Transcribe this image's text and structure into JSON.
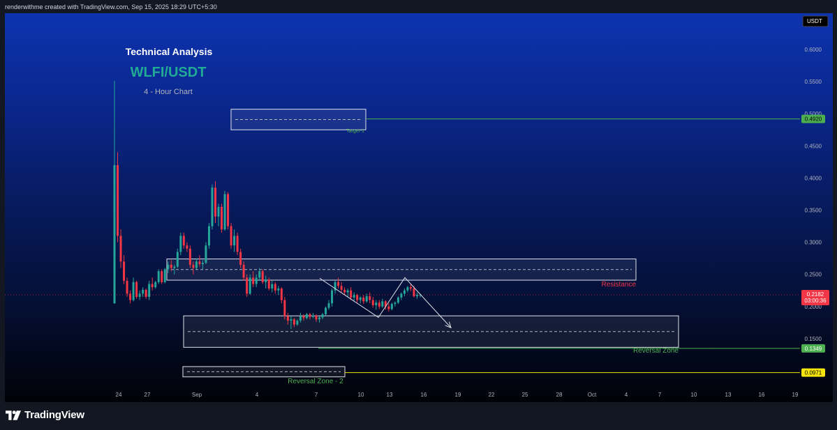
{
  "header": {
    "credit": "renderwithme created with TradingView.com, Sep 15, 2025 18:29 UTC+5:30"
  },
  "footer": {
    "brand": "TradingView"
  },
  "chart_data": {
    "type": "candlestick",
    "title": "Technical Analysis",
    "symbol": "WLFI/USDT",
    "subtitle": "4 - Hour Chart",
    "currency": "USDT",
    "ylim": [
      0.05,
      0.64
    ],
    "y_ticks": [
      "0.6000",
      "0.5500",
      "0.5000",
      "0.4500",
      "0.4000",
      "0.3500",
      "0.3000",
      "0.2500",
      "0.2000",
      "0.1500"
    ],
    "x_ticks": [
      "24",
      "27",
      "Sep",
      "4",
      "7",
      "10",
      "13",
      "16",
      "19",
      "22",
      "25",
      "28",
      "Oct",
      "4",
      "7",
      "10",
      "13",
      "16",
      "19"
    ],
    "last_price": {
      "value": "0.2182",
      "countdown": "03:00:36",
      "color": "#f23645"
    },
    "levels": [
      {
        "label": "0.4920",
        "value": 0.492,
        "color": "#4caf50",
        "text_color": "#000000"
      },
      {
        "label": "0.1349",
        "value": 0.1349,
        "color": "#4caf50",
        "text_color": "#ffffff"
      },
      {
        "label": "0.0971",
        "value": 0.0971,
        "color": "#f5e50a",
        "text_color": "#000000"
      }
    ],
    "zones": [
      {
        "label": "Target-1",
        "top": 0.507,
        "bottom": 0.475,
        "color": "#4caf50"
      },
      {
        "label": "Resistance",
        "top": 0.274,
        "bottom": 0.241,
        "color": "#f23645"
      },
      {
        "label": "Reversal Zone",
        "top": 0.1855,
        "bottom": 0.1365,
        "color": "#4caf50"
      },
      {
        "label": "Reversal Zone - 2",
        "top": 0.1065,
        "bottom": 0.0905,
        "color": "#4caf50"
      }
    ],
    "path_points": [
      [
        "Sep 7",
        0.244
      ],
      [
        "Sep 12",
        0.183
      ],
      [
        "Sep 14",
        0.245
      ],
      [
        "Sep 19",
        0.167
      ]
    ],
    "colors": {
      "up": "#26a69a",
      "down": "#f23645"
    },
    "ohlc": [
      [
        0.205,
        0.435,
        0.205,
        0.42
      ],
      [
        0.42,
        0.44,
        0.3,
        0.31
      ],
      [
        0.31,
        0.32,
        0.26,
        0.27
      ],
      [
        0.27,
        0.28,
        0.235,
        0.24
      ],
      [
        0.24,
        0.245,
        0.215,
        0.22
      ],
      [
        0.22,
        0.225,
        0.205,
        0.21
      ],
      [
        0.21,
        0.245,
        0.208,
        0.238
      ],
      [
        0.238,
        0.24,
        0.212,
        0.215
      ],
      [
        0.215,
        0.225,
        0.21,
        0.22
      ],
      [
        0.22,
        0.23,
        0.215,
        0.226
      ],
      [
        0.226,
        0.228,
        0.212,
        0.215
      ],
      [
        0.215,
        0.24,
        0.21,
        0.235
      ],
      [
        0.235,
        0.245,
        0.225,
        0.23
      ],
      [
        0.23,
        0.24,
        0.228,
        0.238
      ],
      [
        0.238,
        0.258,
        0.235,
        0.255
      ],
      [
        0.255,
        0.258,
        0.235,
        0.238
      ],
      [
        0.238,
        0.26,
        0.236,
        0.258
      ],
      [
        0.258,
        0.27,
        0.252,
        0.265
      ],
      [
        0.265,
        0.272,
        0.255,
        0.26
      ],
      [
        0.26,
        0.265,
        0.25,
        0.262
      ],
      [
        0.262,
        0.29,
        0.26,
        0.285
      ],
      [
        0.285,
        0.315,
        0.28,
        0.31
      ],
      [
        0.31,
        0.315,
        0.29,
        0.295
      ],
      [
        0.295,
        0.3,
        0.285,
        0.29
      ],
      [
        0.29,
        0.295,
        0.26,
        0.265
      ],
      [
        0.265,
        0.27,
        0.25,
        0.26
      ],
      [
        0.26,
        0.275,
        0.258,
        0.27
      ],
      [
        0.27,
        0.28,
        0.262,
        0.266
      ],
      [
        0.266,
        0.272,
        0.258,
        0.268
      ],
      [
        0.268,
        0.3,
        0.266,
        0.295
      ],
      [
        0.295,
        0.33,
        0.29,
        0.325
      ],
      [
        0.325,
        0.39,
        0.32,
        0.385
      ],
      [
        0.385,
        0.395,
        0.33,
        0.34
      ],
      [
        0.34,
        0.36,
        0.325,
        0.355
      ],
      [
        0.355,
        0.36,
        0.315,
        0.32
      ],
      [
        0.32,
        0.38,
        0.318,
        0.375
      ],
      [
        0.375,
        0.378,
        0.32,
        0.325
      ],
      [
        0.325,
        0.33,
        0.29,
        0.295
      ],
      [
        0.295,
        0.32,
        0.285,
        0.31
      ],
      [
        0.31,
        0.315,
        0.28,
        0.285
      ],
      [
        0.285,
        0.29,
        0.26,
        0.265
      ],
      [
        0.265,
        0.27,
        0.24,
        0.245
      ],
      [
        0.245,
        0.25,
        0.215,
        0.22
      ],
      [
        0.22,
        0.25,
        0.218,
        0.245
      ],
      [
        0.245,
        0.255,
        0.23,
        0.235
      ],
      [
        0.235,
        0.25,
        0.23,
        0.245
      ],
      [
        0.245,
        0.26,
        0.24,
        0.255
      ],
      [
        0.255,
        0.258,
        0.235,
        0.238
      ],
      [
        0.238,
        0.248,
        0.228,
        0.242
      ],
      [
        0.242,
        0.245,
        0.225,
        0.228
      ],
      [
        0.228,
        0.24,
        0.222,
        0.235
      ],
      [
        0.235,
        0.238,
        0.22,
        0.225
      ],
      [
        0.225,
        0.232,
        0.218,
        0.228
      ],
      [
        0.228,
        0.23,
        0.205,
        0.21
      ],
      [
        0.21,
        0.215,
        0.18,
        0.185
      ],
      [
        0.185,
        0.19,
        0.172,
        0.178
      ],
      [
        0.178,
        0.185,
        0.165,
        0.18
      ],
      [
        0.18,
        0.182,
        0.168,
        0.172
      ],
      [
        0.172,
        0.18,
        0.17,
        0.178
      ],
      [
        0.178,
        0.19,
        0.175,
        0.185
      ],
      [
        0.185,
        0.188,
        0.178,
        0.182
      ],
      [
        0.182,
        0.19,
        0.18,
        0.188
      ],
      [
        0.188,
        0.19,
        0.18,
        0.184
      ],
      [
        0.184,
        0.19,
        0.182,
        0.186
      ],
      [
        0.186,
        0.188,
        0.176,
        0.18
      ],
      [
        0.18,
        0.185,
        0.175,
        0.183
      ],
      [
        0.183,
        0.19,
        0.18,
        0.188
      ],
      [
        0.188,
        0.2,
        0.186,
        0.198
      ],
      [
        0.198,
        0.21,
        0.195,
        0.205
      ],
      [
        0.205,
        0.228,
        0.2,
        0.225
      ],
      [
        0.225,
        0.24,
        0.22,
        0.238
      ],
      [
        0.238,
        0.245,
        0.228,
        0.232
      ],
      [
        0.232,
        0.238,
        0.222,
        0.226
      ],
      [
        0.226,
        0.23,
        0.218,
        0.222
      ],
      [
        0.222,
        0.228,
        0.215,
        0.225
      ],
      [
        0.225,
        0.23,
        0.21,
        0.214
      ],
      [
        0.214,
        0.222,
        0.208,
        0.218
      ],
      [
        0.218,
        0.22,
        0.206,
        0.21
      ],
      [
        0.21,
        0.216,
        0.205,
        0.214
      ],
      [
        0.214,
        0.218,
        0.204,
        0.208
      ],
      [
        0.208,
        0.22,
        0.206,
        0.216
      ],
      [
        0.216,
        0.222,
        0.205,
        0.21
      ],
      [
        0.21,
        0.215,
        0.198,
        0.202
      ],
      [
        0.202,
        0.21,
        0.195,
        0.206
      ],
      [
        0.206,
        0.21,
        0.196,
        0.2
      ],
      [
        0.2,
        0.212,
        0.198,
        0.208
      ],
      [
        0.208,
        0.21,
        0.195,
        0.2
      ],
      [
        0.2,
        0.205,
        0.192,
        0.196
      ],
      [
        0.196,
        0.206,
        0.194,
        0.204
      ],
      [
        0.204,
        0.208,
        0.2,
        0.206
      ],
      [
        0.206,
        0.216,
        0.204,
        0.214
      ],
      [
        0.214,
        0.222,
        0.21,
        0.22
      ],
      [
        0.22,
        0.228,
        0.216,
        0.225
      ],
      [
        0.225,
        0.232,
        0.222,
        0.23
      ],
      [
        0.23,
        0.236,
        0.224,
        0.228
      ],
      [
        0.228,
        0.232,
        0.214,
        0.216
      ],
      [
        0.216,
        0.222,
        0.212,
        0.218
      ],
      [
        0.218,
        0.22,
        0.214,
        0.2182
      ]
    ]
  }
}
